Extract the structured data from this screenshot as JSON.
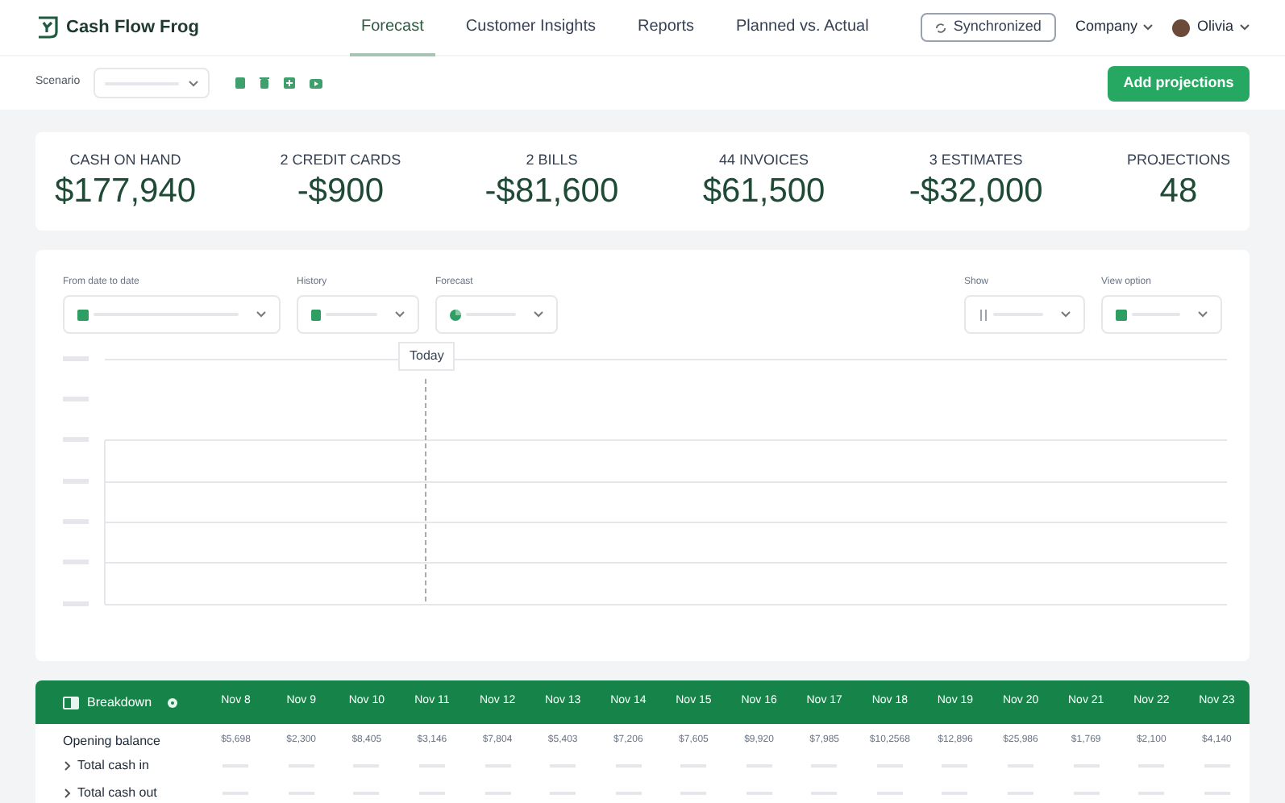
{
  "app": {
    "name": "Cash Flow Frog"
  },
  "nav": [
    {
      "label": "Forecast",
      "selected": true
    },
    {
      "label": "Customer Insights",
      "selected": false
    },
    {
      "label": "Reports",
      "selected": false
    },
    {
      "label": "Planned vs. Actual",
      "selected": false
    }
  ],
  "sync_button": "Synchronized",
  "company_menu": "Company",
  "user_menu": "Olivia",
  "toolbar": {
    "scenario_label": "Scenario",
    "add_button": "Add projections"
  },
  "stats": [
    {
      "label": "CASH ON HAND",
      "value": "$177,940"
    },
    {
      "label": "2 CREDIT CARDS",
      "value": "-$900"
    },
    {
      "label": "2 BILLS",
      "value": "-$81,600"
    },
    {
      "label": "44 INVOICES",
      "value": "$61,500"
    },
    {
      "label": "3 ESTIMATES",
      "value": "-$32,000"
    },
    {
      "label": "PROJECTIONS",
      "value": "48"
    }
  ],
  "filters": [
    {
      "label": "From date to date",
      "kind": "calendar"
    },
    {
      "label": "History",
      "kind": "document"
    },
    {
      "label": "Forecast",
      "kind": "pie"
    },
    {
      "label": "Show",
      "kind": "sort"
    },
    {
      "label": "View option",
      "kind": "calendar"
    }
  ],
  "chart": {
    "marker": "Today"
  },
  "breakdown": {
    "title": "Breakdown",
    "dates": [
      "Nov 8",
      "Nov 9",
      "Nov 10",
      "Nov 11",
      "Nov 12",
      "Nov 13",
      "Nov 14",
      "Nov 15",
      "Nov 16",
      "Nov 17",
      "Nov 18",
      "Nov 19",
      "Nov 20",
      "Nov 21",
      "Nov 22",
      "Nov 23"
    ],
    "rows": [
      {
        "label": "Opening balance",
        "expandable": false,
        "values": [
          "$5,698",
          "$2,300",
          "$8,405",
          "$3,146",
          "$7,804",
          "$5,403",
          "$7,206",
          "$7,605",
          "$9,920",
          "$7,985",
          "$10,2568",
          "$12,896",
          "$25,986",
          "$1,769",
          "$2,100",
          "$4,140"
        ]
      },
      {
        "label": "Total cash in",
        "expandable": true
      },
      {
        "label": "Total cash out",
        "expandable": true
      }
    ]
  }
}
